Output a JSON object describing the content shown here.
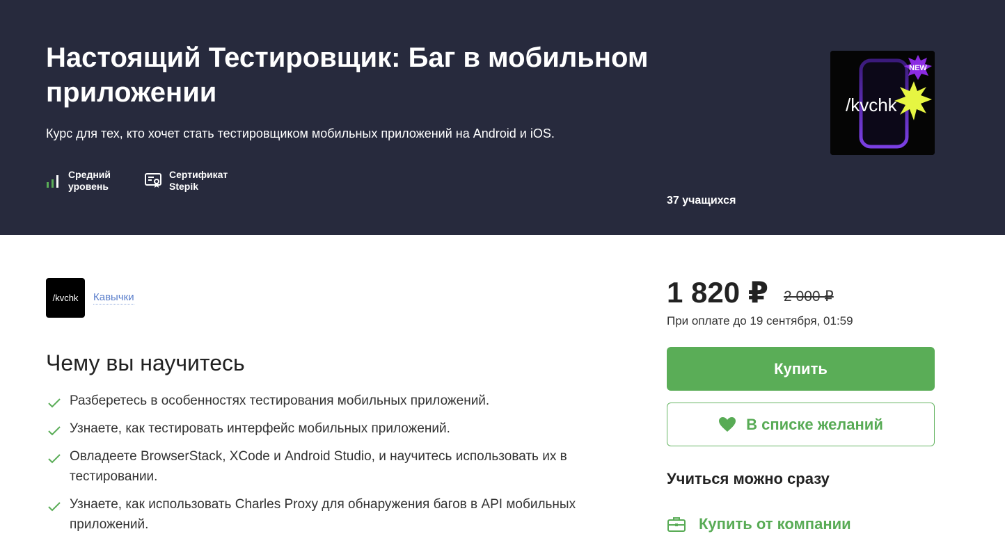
{
  "hero": {
    "title": "Настоящий Тестировщик: Баг в мобильном приложении",
    "subtitle": "Курс для тех, кто хочет стать тестировщиком мобильных приложений на Android и iOS.",
    "level": {
      "line1": "Средний",
      "line2": "уровень",
      "icon": "level-bars-icon"
    },
    "certificate": {
      "line1": "Сертификат",
      "line2": "Stepik",
      "icon": "certificate-icon"
    },
    "cover": {
      "logo_text": "/kvchk",
      "badge": "NEW"
    },
    "students": "37 учащихся"
  },
  "author": {
    "logo_text": "/kvchk",
    "name": "Кавычки"
  },
  "learn": {
    "heading": "Чему вы научитесь",
    "items": [
      "Разберетесь в особенностях тестирования мобильных приложений.",
      "Узнаете, как тестировать интерфейс мобильных приложений.",
      "Овладеете BrowserStack, XCode и Android Studio, и научитесь использовать их в тестировании.",
      "Узнаете, как использовать Charles Proxy для обнаружения багов в API мобильных приложений."
    ]
  },
  "purchase": {
    "price": "1 820 ₽",
    "old_price": "2 000 ₽",
    "deadline": "При оплате до 19 сентября, 01:59",
    "buy_label": "Купить",
    "wishlist_label": "В списке желаний",
    "learn_now": "Учиться можно сразу",
    "buy_company_label": "Купить от компании"
  },
  "colors": {
    "hero_bg": "#272a3d",
    "accent_green": "#5aad57",
    "link_blue": "#5a7ecb"
  }
}
